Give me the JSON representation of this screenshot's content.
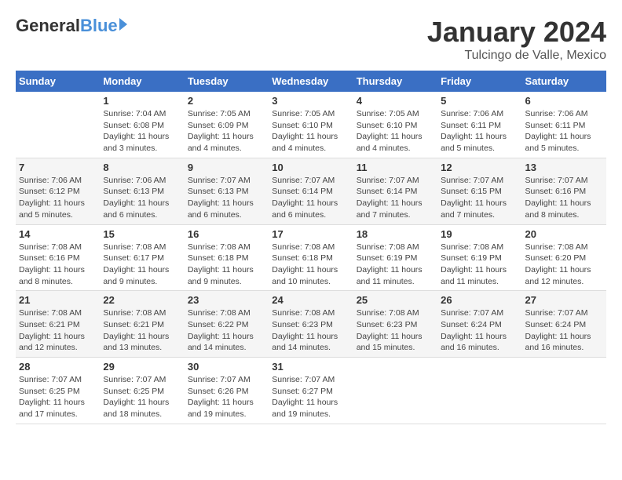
{
  "logo": {
    "general": "General",
    "blue": "Blue"
  },
  "title": "January 2024",
  "subtitle": "Tulcingo de Valle, Mexico",
  "days_of_week": [
    "Sunday",
    "Monday",
    "Tuesday",
    "Wednesday",
    "Thursday",
    "Friday",
    "Saturday"
  ],
  "weeks": [
    [
      {
        "day": "",
        "sunrise": "",
        "sunset": "",
        "daylight": ""
      },
      {
        "day": "1",
        "sunrise": "Sunrise: 7:04 AM",
        "sunset": "Sunset: 6:08 PM",
        "daylight": "Daylight: 11 hours and 3 minutes."
      },
      {
        "day": "2",
        "sunrise": "Sunrise: 7:05 AM",
        "sunset": "Sunset: 6:09 PM",
        "daylight": "Daylight: 11 hours and 4 minutes."
      },
      {
        "day": "3",
        "sunrise": "Sunrise: 7:05 AM",
        "sunset": "Sunset: 6:10 PM",
        "daylight": "Daylight: 11 hours and 4 minutes."
      },
      {
        "day": "4",
        "sunrise": "Sunrise: 7:05 AM",
        "sunset": "Sunset: 6:10 PM",
        "daylight": "Daylight: 11 hours and 4 minutes."
      },
      {
        "day": "5",
        "sunrise": "Sunrise: 7:06 AM",
        "sunset": "Sunset: 6:11 PM",
        "daylight": "Daylight: 11 hours and 5 minutes."
      },
      {
        "day": "6",
        "sunrise": "Sunrise: 7:06 AM",
        "sunset": "Sunset: 6:11 PM",
        "daylight": "Daylight: 11 hours and 5 minutes."
      }
    ],
    [
      {
        "day": "7",
        "sunrise": "Sunrise: 7:06 AM",
        "sunset": "Sunset: 6:12 PM",
        "daylight": "Daylight: 11 hours and 5 minutes."
      },
      {
        "day": "8",
        "sunrise": "Sunrise: 7:06 AM",
        "sunset": "Sunset: 6:13 PM",
        "daylight": "Daylight: 11 hours and 6 minutes."
      },
      {
        "day": "9",
        "sunrise": "Sunrise: 7:07 AM",
        "sunset": "Sunset: 6:13 PM",
        "daylight": "Daylight: 11 hours and 6 minutes."
      },
      {
        "day": "10",
        "sunrise": "Sunrise: 7:07 AM",
        "sunset": "Sunset: 6:14 PM",
        "daylight": "Daylight: 11 hours and 6 minutes."
      },
      {
        "day": "11",
        "sunrise": "Sunrise: 7:07 AM",
        "sunset": "Sunset: 6:14 PM",
        "daylight": "Daylight: 11 hours and 7 minutes."
      },
      {
        "day": "12",
        "sunrise": "Sunrise: 7:07 AM",
        "sunset": "Sunset: 6:15 PM",
        "daylight": "Daylight: 11 hours and 7 minutes."
      },
      {
        "day": "13",
        "sunrise": "Sunrise: 7:07 AM",
        "sunset": "Sunset: 6:16 PM",
        "daylight": "Daylight: 11 hours and 8 minutes."
      }
    ],
    [
      {
        "day": "14",
        "sunrise": "Sunrise: 7:08 AM",
        "sunset": "Sunset: 6:16 PM",
        "daylight": "Daylight: 11 hours and 8 minutes."
      },
      {
        "day": "15",
        "sunrise": "Sunrise: 7:08 AM",
        "sunset": "Sunset: 6:17 PM",
        "daylight": "Daylight: 11 hours and 9 minutes."
      },
      {
        "day": "16",
        "sunrise": "Sunrise: 7:08 AM",
        "sunset": "Sunset: 6:18 PM",
        "daylight": "Daylight: 11 hours and 9 minutes."
      },
      {
        "day": "17",
        "sunrise": "Sunrise: 7:08 AM",
        "sunset": "Sunset: 6:18 PM",
        "daylight": "Daylight: 11 hours and 10 minutes."
      },
      {
        "day": "18",
        "sunrise": "Sunrise: 7:08 AM",
        "sunset": "Sunset: 6:19 PM",
        "daylight": "Daylight: 11 hours and 11 minutes."
      },
      {
        "day": "19",
        "sunrise": "Sunrise: 7:08 AM",
        "sunset": "Sunset: 6:19 PM",
        "daylight": "Daylight: 11 hours and 11 minutes."
      },
      {
        "day": "20",
        "sunrise": "Sunrise: 7:08 AM",
        "sunset": "Sunset: 6:20 PM",
        "daylight": "Daylight: 11 hours and 12 minutes."
      }
    ],
    [
      {
        "day": "21",
        "sunrise": "Sunrise: 7:08 AM",
        "sunset": "Sunset: 6:21 PM",
        "daylight": "Daylight: 11 hours and 12 minutes."
      },
      {
        "day": "22",
        "sunrise": "Sunrise: 7:08 AM",
        "sunset": "Sunset: 6:21 PM",
        "daylight": "Daylight: 11 hours and 13 minutes."
      },
      {
        "day": "23",
        "sunrise": "Sunrise: 7:08 AM",
        "sunset": "Sunset: 6:22 PM",
        "daylight": "Daylight: 11 hours and 14 minutes."
      },
      {
        "day": "24",
        "sunrise": "Sunrise: 7:08 AM",
        "sunset": "Sunset: 6:23 PM",
        "daylight": "Daylight: 11 hours and 14 minutes."
      },
      {
        "day": "25",
        "sunrise": "Sunrise: 7:08 AM",
        "sunset": "Sunset: 6:23 PM",
        "daylight": "Daylight: 11 hours and 15 minutes."
      },
      {
        "day": "26",
        "sunrise": "Sunrise: 7:07 AM",
        "sunset": "Sunset: 6:24 PM",
        "daylight": "Daylight: 11 hours and 16 minutes."
      },
      {
        "day": "27",
        "sunrise": "Sunrise: 7:07 AM",
        "sunset": "Sunset: 6:24 PM",
        "daylight": "Daylight: 11 hours and 16 minutes."
      }
    ],
    [
      {
        "day": "28",
        "sunrise": "Sunrise: 7:07 AM",
        "sunset": "Sunset: 6:25 PM",
        "daylight": "Daylight: 11 hours and 17 minutes."
      },
      {
        "day": "29",
        "sunrise": "Sunrise: 7:07 AM",
        "sunset": "Sunset: 6:25 PM",
        "daylight": "Daylight: 11 hours and 18 minutes."
      },
      {
        "day": "30",
        "sunrise": "Sunrise: 7:07 AM",
        "sunset": "Sunset: 6:26 PM",
        "daylight": "Daylight: 11 hours and 19 minutes."
      },
      {
        "day": "31",
        "sunrise": "Sunrise: 7:07 AM",
        "sunset": "Sunset: 6:27 PM",
        "daylight": "Daylight: 11 hours and 19 minutes."
      },
      {
        "day": "",
        "sunrise": "",
        "sunset": "",
        "daylight": ""
      },
      {
        "day": "",
        "sunrise": "",
        "sunset": "",
        "daylight": ""
      },
      {
        "day": "",
        "sunrise": "",
        "sunset": "",
        "daylight": ""
      }
    ]
  ]
}
